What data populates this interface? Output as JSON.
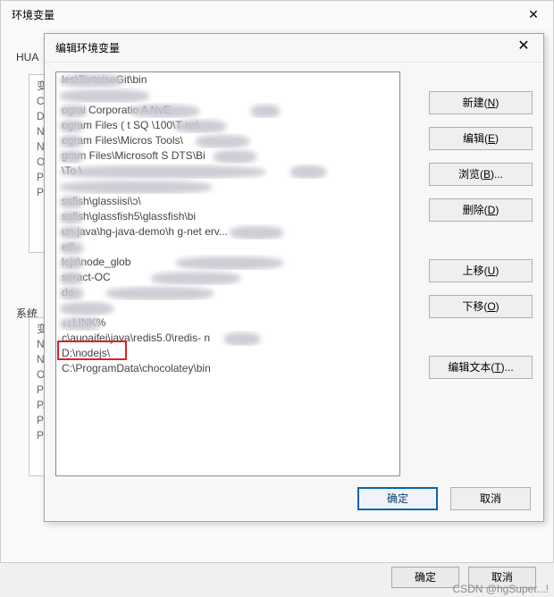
{
  "outer": {
    "title": "环境变量",
    "hua_label": "HUA",
    "sys_label": "系统",
    "group1_rows": [
      "变",
      "Cl",
      "Dl",
      "N",
      "N",
      "O",
      "Pa",
      "Py"
    ],
    "group2_rows": [
      "变",
      "N",
      "N",
      "O",
      "Pa",
      "PA",
      "PE",
      "PR"
    ],
    "ok": "确定",
    "cancel": "取消"
  },
  "inner": {
    "title": "编辑环境变量",
    "items": [
      "            les\\TortoiseGit\\bin",
      "",
      "      ograi             Corporatio         A NvE",
      "       ogram Files (               t SQ         \\100\\T        nn\\",
      "       ogram Files\\Micros                    Tools\\",
      "       gram Files\\Microsoft S               DTS\\Bi",
      "                                            \\To          \\",
      "",
      "       ssfish\\glassiisi\\ɔ\\",
      "       ssfish\\glassfish5\\glassfish\\bi",
      "       un-java\\hg-java-demo\\h               g-net        erv...",
      "       ell\\",
      "       lejs\\node_glob",
      "       seract-OC",
      "       de",
      "",
      "        ↓↓LINK%",
      "c\\auoaifei\\java\\redis5.0\\redis-           n",
      "D:\\nodejs\\",
      "C:\\ProgramData\\chocolatey\\bin"
    ],
    "buttons": {
      "new": "新建(",
      "new_u": "N",
      "new_end": ")",
      "edit": "编辑(",
      "edit_u": "E",
      "edit_end": ")",
      "browse": "浏览(",
      "browse_u": "B",
      "browse_end": ")...",
      "delete": "删除(",
      "delete_u": "D",
      "delete_end": ")",
      "up": "上移(",
      "up_u": "U",
      "up_end": ")",
      "down": "下移(",
      "down_u": "O",
      "down_end": ")",
      "text": "编辑文本(",
      "text_u": "T",
      "text_end": ")..."
    },
    "ok": "确定",
    "cancel": "取消"
  },
  "watermark": "CSDN @hgSuper...!"
}
